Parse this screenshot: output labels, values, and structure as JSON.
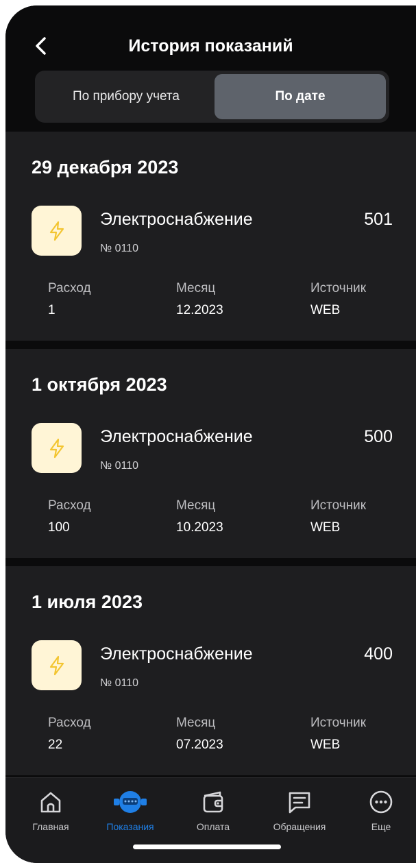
{
  "header": {
    "title": "История показаний",
    "tabs": [
      {
        "label": "По прибору учета",
        "active": false
      },
      {
        "label": "По дате",
        "active": true
      }
    ]
  },
  "entries": [
    {
      "date": "29 декабря 2023",
      "service": "Электроснабжение",
      "meter_number": "№ 0110",
      "reading": "501",
      "consumption_label": "Расход",
      "consumption": "1",
      "month_label": "Месяц",
      "month": "12.2023",
      "source_label": "Источник",
      "source": "WEB",
      "icon": "lightning-icon"
    },
    {
      "date": "1 октября 2023",
      "service": "Электроснабжение",
      "meter_number": "№ 0110",
      "reading": "500",
      "consumption_label": "Расход",
      "consumption": "100",
      "month_label": "Месяц",
      "month": "10.2023",
      "source_label": "Источник",
      "source": "WEB",
      "icon": "lightning-icon"
    },
    {
      "date": "1 июля 2023",
      "service": "Электроснабжение",
      "meter_number": "№ 0110",
      "reading": "400",
      "consumption_label": "Расход",
      "consumption": "22",
      "month_label": "Месяц",
      "month": "07.2023",
      "source_label": "Источник",
      "source": "WEB",
      "icon": "lightning-icon"
    }
  ],
  "tabbar": {
    "items": [
      {
        "label": "Главная",
        "icon": "home-icon",
        "active": false
      },
      {
        "label": "Показания",
        "icon": "meter-icon",
        "active": true
      },
      {
        "label": "Оплата",
        "icon": "wallet-icon",
        "active": false
      },
      {
        "label": "Обращения",
        "icon": "message-icon",
        "active": false
      },
      {
        "label": "Еще",
        "icon": "more-icon",
        "active": false
      }
    ]
  },
  "colors": {
    "background": "#0b0b0c",
    "card": "#1e1e20",
    "accent": "#1f7fe6",
    "icon_bg": "#fff5d6",
    "lightning": "#f3c531"
  }
}
